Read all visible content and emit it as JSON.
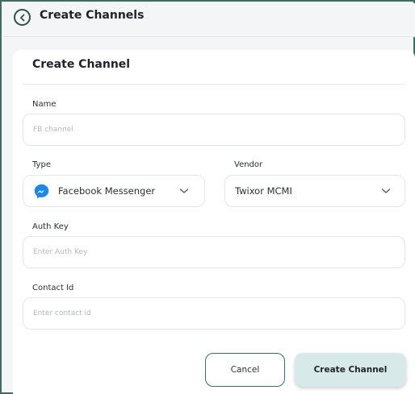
{
  "header": {
    "title": "Create Channels",
    "back_icon": "chevron-left-circle-icon"
  },
  "form": {
    "title": "Create Channel",
    "name": {
      "label": "Name",
      "value": "",
      "placeholder": "FB channel"
    },
    "type": {
      "label": "Type",
      "selected": "Facebook Messenger",
      "icon": "facebook-messenger-icon"
    },
    "vendor": {
      "label": "Vendor",
      "selected": "Twixor MCMI"
    },
    "auth_key": {
      "label": "Auth Key",
      "value": "",
      "placeholder": "Enter Auth Key"
    },
    "contact_id": {
      "label": "Contact Id",
      "value": "",
      "placeholder": "Enter contact id"
    }
  },
  "actions": {
    "cancel_label": "Cancel",
    "create_label": "Create Channel"
  },
  "colors": {
    "accent": "#3f6b63",
    "primary_button_bg": "#d7e9e9",
    "messenger_blue": "#1e88e5"
  }
}
